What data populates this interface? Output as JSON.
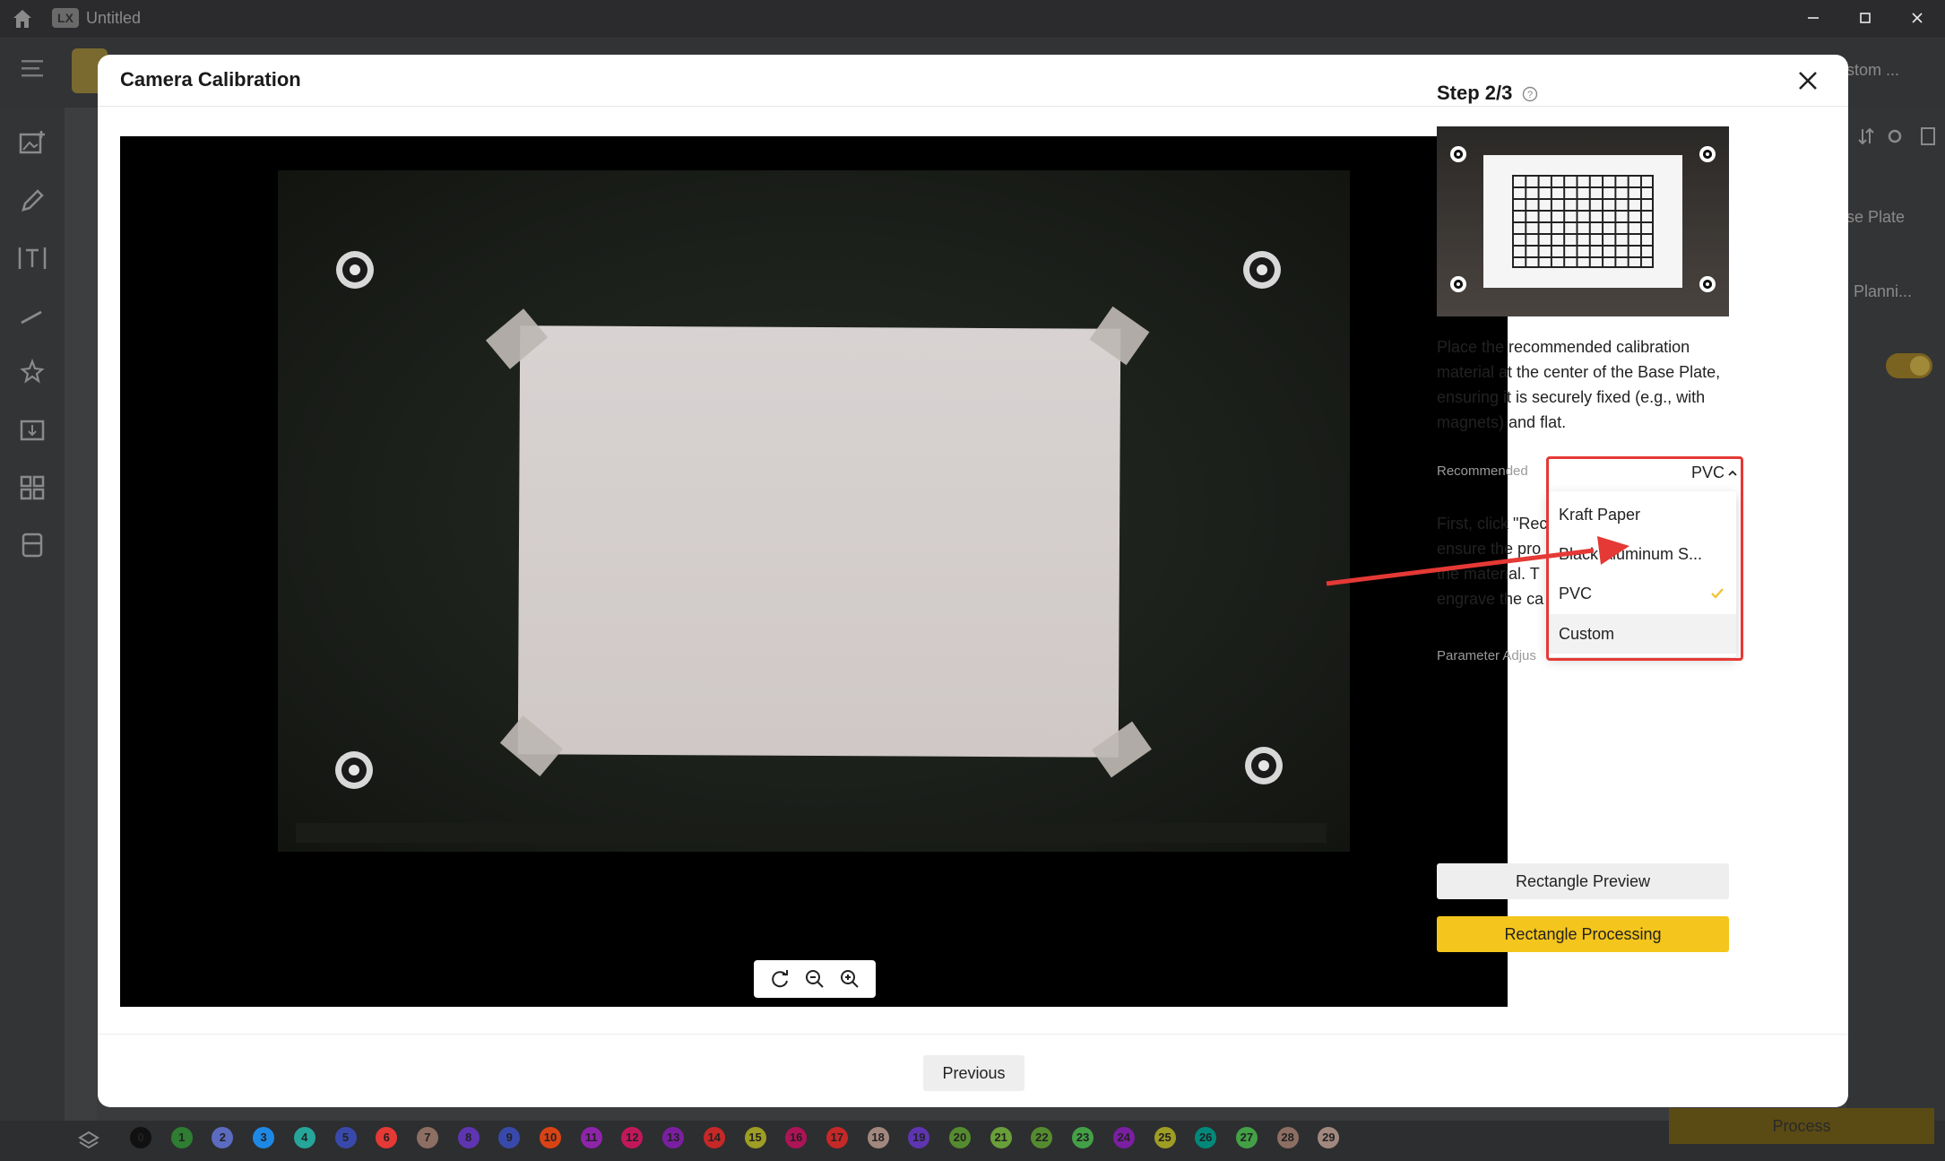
{
  "window": {
    "document_title": "Untitled",
    "app_badge": "LX",
    "minimize_icon": "minimize-icon",
    "maximize_icon": "maximize-icon",
    "close_icon": "close-icon"
  },
  "background": {
    "toolbar_custom": "stom ...",
    "right_panel": {
      "base_plate": "se Plate",
      "planning": "Planni...",
      "process_button": "Process"
    },
    "layers": [
      "0",
      "1",
      "2",
      "3",
      "4",
      "5",
      "6",
      "7",
      "8",
      "9",
      "10",
      "11",
      "12",
      "13",
      "14",
      "15",
      "16",
      "17",
      "18",
      "19",
      "20",
      "21",
      "22",
      "23",
      "24",
      "25",
      "26",
      "27",
      "28",
      "29"
    ],
    "layer_colors": [
      "#111111",
      "#2e7d32",
      "#5c6bc0",
      "#1e88e5",
      "#26a69a",
      "#3949ab",
      "#e53935",
      "#8d6e63",
      "#5e35b1",
      "#3949ab",
      "#d84315",
      "#8e24aa",
      "#c2185b",
      "#7b1fa2",
      "#c62828",
      "#9e9d24",
      "#ad1457",
      "#c62828",
      "#a1887f",
      "#5e35b1",
      "#558b2f",
      "#689f38",
      "#558b2f",
      "#43a047",
      "#7b1fa2",
      "#9e9d24",
      "#00897b",
      "#43a047",
      "#8d6e63",
      "#a1887f"
    ]
  },
  "modal": {
    "title": "Camera Calibration",
    "step": {
      "title": "Step 2/3",
      "help_icon": "help-circle-icon"
    },
    "description": "Place the recommended calibration material at the center of the Base Plate, ensuring it is securely fixed (e.g., with magnets) and flat.",
    "recommended_label": "Recommended",
    "info_lines": [
      "First, click \"Rec",
      "ensure the pro",
      "the material. T",
      "engrave the ca"
    ],
    "parameter_label": "Parameter Adjus",
    "material_select": {
      "selected": "PVC",
      "options": [
        {
          "label": "Kraft Paper",
          "selected": false
        },
        {
          "label": "Black Aluminum S...",
          "selected": false
        },
        {
          "label": "PVC",
          "selected": true
        },
        {
          "label": "Custom",
          "selected": false
        }
      ]
    },
    "buttons": {
      "rectangle_preview": "Rectangle Preview",
      "rectangle_processing": "Rectangle Processing",
      "previous": "Previous"
    },
    "camera_controls": [
      "rotate-icon",
      "zoom-out-icon",
      "zoom-in-icon"
    ],
    "colors": {
      "accent": "#f4c51c",
      "highlight": "#e53935",
      "check": "#f0c230"
    }
  }
}
